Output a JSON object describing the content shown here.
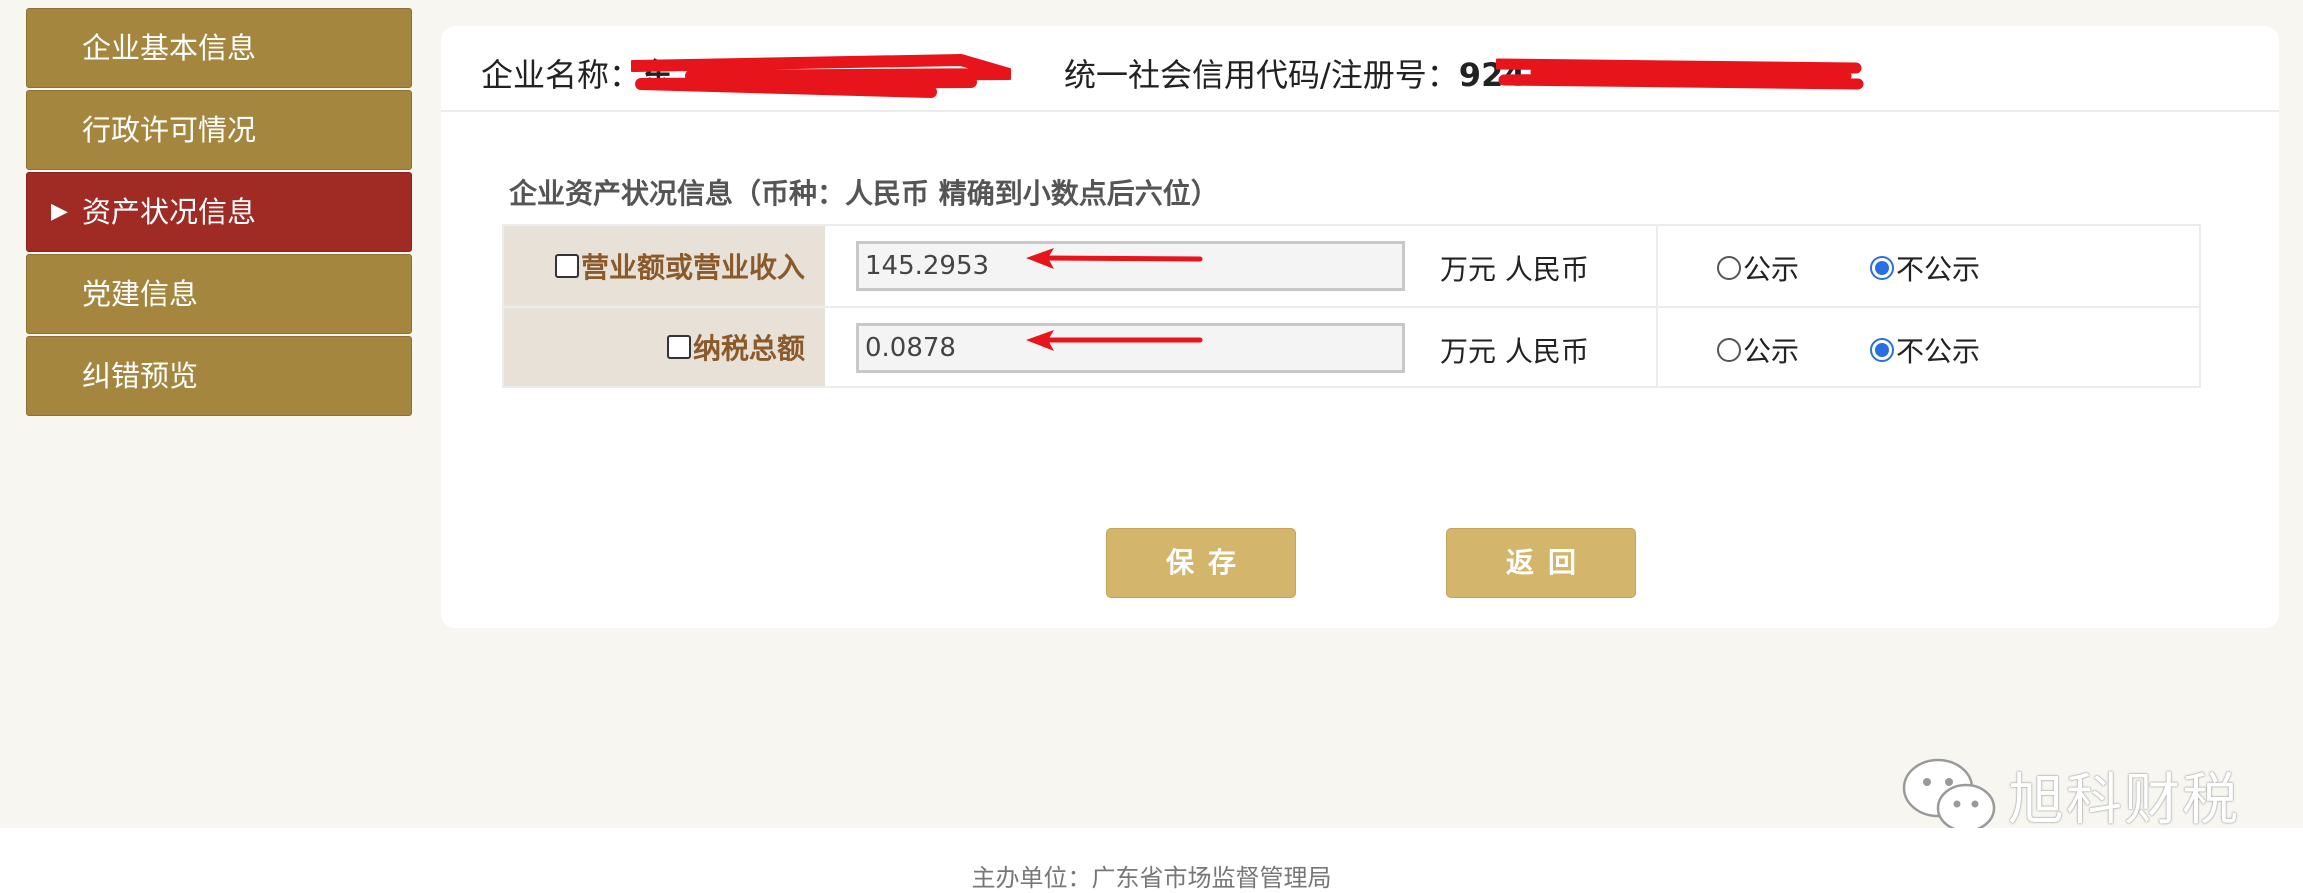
{
  "sidebar": {
    "items": [
      {
        "label": "企业基本信息",
        "active": false
      },
      {
        "label": "行政许可情况",
        "active": false
      },
      {
        "label": "资产状况信息",
        "active": true
      },
      {
        "label": "党建信息",
        "active": false
      },
      {
        "label": "纠错预览",
        "active": false
      }
    ],
    "active_marker": "▶"
  },
  "header": {
    "name_label": "企业名称：",
    "name_value": "东",
    "code_label": "统一社会信用代码/注册号：",
    "code_value": "924"
  },
  "section": {
    "title": "企业资产状况信息（币种：人民币 精确到小数点后六位）"
  },
  "rows": [
    {
      "label": "营业额或营业收入",
      "checked": false,
      "value": "145.2953",
      "unit": "万元 人民币",
      "option_public": "公示",
      "option_private": "不公示",
      "selected": "不公示"
    },
    {
      "label": "纳税总额",
      "checked": false,
      "value": "0.0878",
      "unit": "万元 人民币",
      "option_public": "公示",
      "option_private": "不公示",
      "selected": "不公示"
    }
  ],
  "buttons": {
    "save": "保存",
    "back": "返回"
  },
  "watermark": {
    "text": "旭科财税",
    "icon": "wechat-icon"
  },
  "footer": {
    "text": "主办单位：广东省市场监督管理局"
  },
  "colors": {
    "sidebar_bg": "#a5863e",
    "sidebar_active": "#a02a24",
    "button_bg": "#d3b56b",
    "label_bg": "#e8e1d8",
    "label_text": "#8a5a2b",
    "radio_selected": "#2a6fe0",
    "annotation_red": "#e8141c"
  }
}
